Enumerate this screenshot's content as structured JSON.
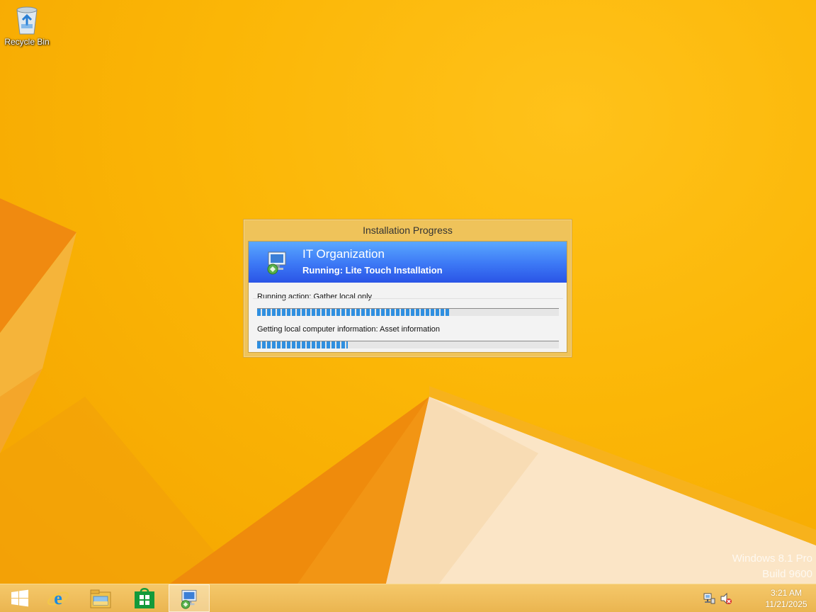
{
  "desktop": {
    "icons": [
      {
        "label": "Recycle Bin",
        "icon": "recycle-bin-icon"
      }
    ],
    "watermark": {
      "line1": "Windows 8.1 Pro",
      "line2": "Build 9600"
    }
  },
  "progress_window": {
    "title": "Installation Progress",
    "banner": {
      "organization": "IT Organization",
      "status": "Running: Lite Touch Installation",
      "icon": "deployment-computer-icon"
    },
    "action": {
      "label": "Running action: Gather local only",
      "progress": 0.64
    },
    "step": {
      "label": "Getting local computer information: Asset information",
      "progress": 0.3
    }
  },
  "taskbar": {
    "items": [
      {
        "name": "start",
        "icon": "windows-logo-icon",
        "active": false
      },
      {
        "name": "internet-explorer",
        "icon": "internet-explorer-icon",
        "active": false
      },
      {
        "name": "file-explorer",
        "icon": "file-explorer-icon",
        "active": false
      },
      {
        "name": "store",
        "icon": "store-icon",
        "active": false
      },
      {
        "name": "deployment-wizard",
        "icon": "deployment-computer-icon",
        "active": true
      }
    ],
    "tray": {
      "network_icon": "network-icon",
      "volume_icon": "volume-muted-icon",
      "time": "3:21 AM",
      "date": "11/21/2025"
    }
  },
  "colors": {
    "wallpaper": "#f9b400",
    "banner_top": "#5aa8ff",
    "banner_bottom": "#2a54e6",
    "progress_fill": "#2f8fe0",
    "taskbar": "#eab550"
  }
}
